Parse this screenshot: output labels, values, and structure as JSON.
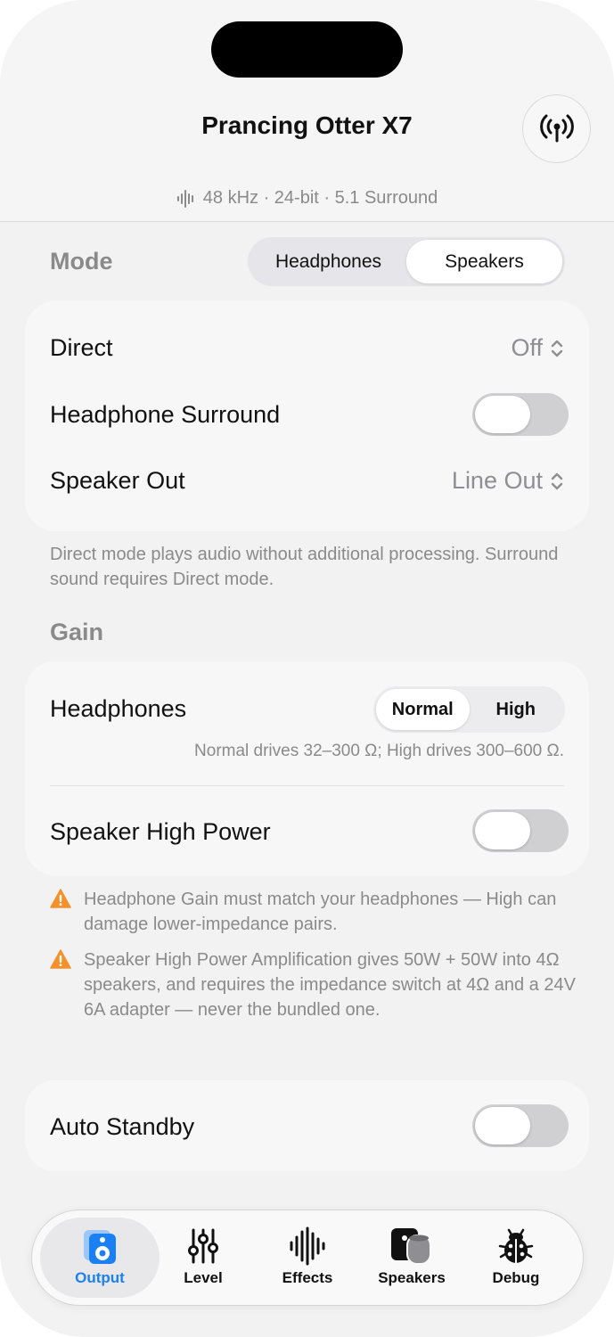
{
  "header": {
    "title": "Prancing Otter X7",
    "format": "48 kHz · 24-bit · 5.1 Surround",
    "antenna_icon": "antenna-radiowaves-icon"
  },
  "mode": {
    "label": "Mode",
    "options": [
      "Headphones",
      "Speakers"
    ],
    "selected": "Speakers"
  },
  "settings": {
    "direct_label": "Direct",
    "direct_value": "Off",
    "surround_label": "Headphone Surround",
    "surround_on": false,
    "speaker_out_label": "Speaker Out",
    "speaker_out_value": "Line Out",
    "note": "Direct mode plays audio without additional processing. Surround sound requires Direct mode."
  },
  "gain": {
    "label": "Gain",
    "headphones_label": "Headphones",
    "options": [
      "Normal",
      "High"
    ],
    "selected": "Normal",
    "headphones_hint": "Normal drives 32–300 Ω; High drives 300–600 Ω.",
    "speaker_high_power_label": "Speaker High Power",
    "speaker_high_power_on": false
  },
  "warnings": [
    "Headphone Gain must match your headphones — High can damage lower-impedance pairs.",
    "Speaker High Power Amplification gives 50W + 50W into 4Ω speakers, and requires the impedance switch at 4Ω and a 24V 6A adapter — never the bundled one."
  ],
  "standby": {
    "label": "Auto Standby",
    "on": false
  },
  "tabbar": {
    "tabs": [
      {
        "label": "Output",
        "icon": "speaker-box-icon"
      },
      {
        "label": "Level",
        "icon": "sliders-icon"
      },
      {
        "label": "Effects",
        "icon": "waveform-icon"
      },
      {
        "label": "Speakers",
        "icon": "homepod-icon"
      },
      {
        "label": "Debug",
        "icon": "ladybug-icon"
      }
    ],
    "selected": "Output"
  },
  "colors": {
    "accent": "#1b80f2",
    "warning": "#f5902b"
  }
}
